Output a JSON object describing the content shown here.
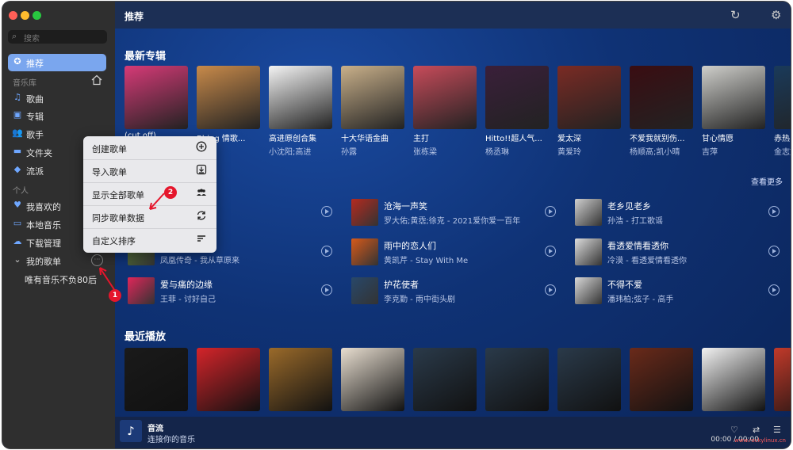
{
  "sidebar": {
    "search_placeholder": "搜索",
    "recommend": "推荐",
    "library_header": "音乐库",
    "items": [
      {
        "label": "歌曲",
        "icon": "music-note-icon"
      },
      {
        "label": "专辑",
        "icon": "album-icon"
      },
      {
        "label": "歌手",
        "icon": "people-icon"
      },
      {
        "label": "文件夹",
        "icon": "folder-icon"
      },
      {
        "label": "流派",
        "icon": "tag-icon"
      }
    ],
    "personal_header": "个人",
    "personal_items": [
      {
        "label": "我喜欢的",
        "icon": "heart-icon"
      },
      {
        "label": "本地音乐",
        "icon": "monitor-icon"
      },
      {
        "label": "下载管理",
        "icon": "cloud-download-icon"
      }
    ],
    "my_playlists": "我的歌单",
    "playlist_item": "唯有音乐不负80后"
  },
  "header": {
    "title": "推荐"
  },
  "sections": {
    "new_albums": "最新专辑",
    "recent": "最近播放",
    "see_more": "查看更多"
  },
  "albums": [
    {
      "title": "(cut off)",
      "artist": "",
      "color": "#d63a77"
    },
    {
      "title": "Bbing 情歌...",
      "artist": "",
      "color": "#c88a4a"
    },
    {
      "title": "高进原创合集",
      "artist": "小沈阳;高进",
      "color": "#f4f4f4"
    },
    {
      "title": "十大华语金曲",
      "artist": "孙露",
      "color": "#c9b08a"
    },
    {
      "title": "主打",
      "artist": "张栋梁",
      "color": "#c74b5a"
    },
    {
      "title": "Hitto!!超人气...",
      "artist": "杨丞琳",
      "color": "#3a1f3a"
    },
    {
      "title": "爱太深",
      "artist": "黄爱玲",
      "color": "#7a2b24"
    },
    {
      "title": "不爱我就别伤...",
      "artist": "杨顺高;凯小晴",
      "color": "#3a0d12"
    },
    {
      "title": "甘心情愿",
      "artist": "吉萍",
      "color": "#cfcfcb"
    },
    {
      "title": "赤热",
      "artist": "金志文",
      "color": "#1a3a5a"
    }
  ],
  "songs": [
    {
      "title": "",
      "artist": "",
      "color": "#2e5fa4"
    },
    {
      "title": "",
      "artist": "凤凰传奇 - 我从草原来",
      "color": "#5a7a3a"
    },
    {
      "title": "爱与痛的边缘",
      "artist": "王菲 - 讨好自己",
      "color": "#e0265a"
    },
    {
      "title": "沧海一声笑",
      "artist": "罗大佑;黄霑;徐克 - 2021爱你爱一百年",
      "color": "#b52a1f"
    },
    {
      "title": "雨中的恋人们",
      "artist": "黄凯芹 - Stay With Me",
      "color": "#d75a1a"
    },
    {
      "title": "护花使者",
      "artist": "李克勤 - 雨中街头剧",
      "color": "#28486a"
    },
    {
      "title": "老乡见老乡",
      "artist": "孙浩 - 打工歌谣",
      "color": "#cfcfcf"
    },
    {
      "title": "看透爱情看透你",
      "artist": "冷漠 - 看透爱情看透你",
      "color": "#dcdcdc"
    },
    {
      "title": "不得不爱",
      "artist": "潘玮柏;弦子 - 高手",
      "color": "#d8d8d8"
    }
  ],
  "recent_colors": [
    "#1a1a1a",
    "#d4242a",
    "#9a6a2a",
    "#e8ded0",
    "#2a3a4a",
    "#2a3a4a",
    "#2a3a4a",
    "#6a2a1a",
    "#f2f2f2",
    "#c23a2a"
  ],
  "context_menu": [
    {
      "label": "创建歌单",
      "icon": "plus-circle-icon"
    },
    {
      "label": "导入歌单",
      "icon": "import-icon"
    },
    {
      "label": "显示全部歌单",
      "icon": "people-icon"
    },
    {
      "label": "同步歌单数据",
      "icon": "sync-icon"
    },
    {
      "label": "自定义排序",
      "icon": "sort-icon"
    }
  ],
  "badges": {
    "one": "1",
    "two": "2"
  },
  "player": {
    "title": "音流",
    "subtitle": "连接你的音乐",
    "time": "00:00 / 00:00"
  },
  "album_row1_labels": {
    "covers_text": "2021"
  },
  "watermark": "www.rockylinux.cn"
}
